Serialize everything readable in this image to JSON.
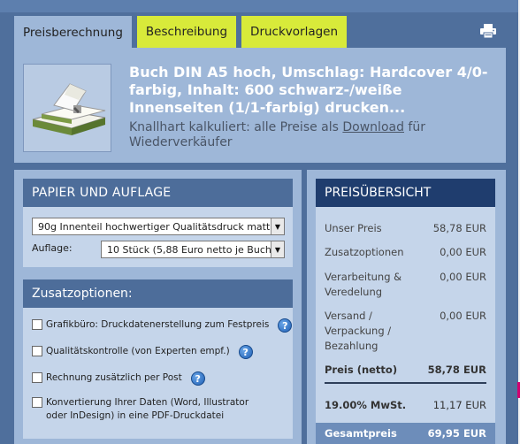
{
  "tabs": [
    {
      "label": "Preisberechnung",
      "active": true
    },
    {
      "label": "Beschreibung",
      "active": false
    },
    {
      "label": "Druckvorlagen",
      "active": false
    }
  ],
  "toolbar": {
    "print_icon": "print-icon"
  },
  "product": {
    "title": "Buch DIN A5 hoch, Umschlag: Hardcover 4/0-farbig, Inhalt: 600 schwarz-/weiße Innenseiten (1/1-farbig) drucken...",
    "note_prefix": "Knallhart kalkuliert: alle Preise als ",
    "note_link": "Download",
    "note_suffix": " für Wiederverkäufer"
  },
  "paper": {
    "heading": "PAPIER UND AUFLAGE",
    "paper_value": "90g Innenteil hochwertiger Qualitätsdruck matt",
    "auflage_label": "Auflage:",
    "auflage_value": "10 Stück (5,88 Euro netto je Buch)"
  },
  "extras": {
    "heading": "Zusatzoptionen:",
    "options": [
      {
        "label": "Grafikbüro: Druckdatenerstellung zum Festpreis",
        "checked": false
      },
      {
        "label": "Qualitätskontrolle (von Experten empf.)",
        "checked": false
      },
      {
        "label": "Rechnung zusätzlich per Post",
        "checked": false
      },
      {
        "label": "Konvertierung Ihrer Daten (Word, Illustrator oder InDesign) in eine PDF-Druckdatei",
        "checked": false
      }
    ],
    "help_glyph": "?"
  },
  "prices": {
    "heading": "PREISÜBERSICHT",
    "rows": [
      {
        "label": "Unser Preis",
        "value": "58,78 EUR"
      },
      {
        "label": "Zusatzoptionen",
        "value": "0,00 EUR"
      },
      {
        "label": "Verarbeitung & Veredelung",
        "value": "0,00 EUR"
      },
      {
        "label": "Versand / Verpackung / Bezahlung",
        "value": "0,00 EUR"
      },
      {
        "label": "Preis (netto)",
        "value": "58,78 EUR"
      },
      {
        "label": "19.00% MwSt.",
        "value": "11,17 EUR"
      },
      {
        "label": "Gesamtpreis",
        "value": "69,95 EUR"
      }
    ]
  },
  "colors": {
    "tab_inactive": "#d8ea3a",
    "panel": "#9eb7d8",
    "header_dark": "#1f3d6e",
    "frame": "#4f6f9c"
  }
}
